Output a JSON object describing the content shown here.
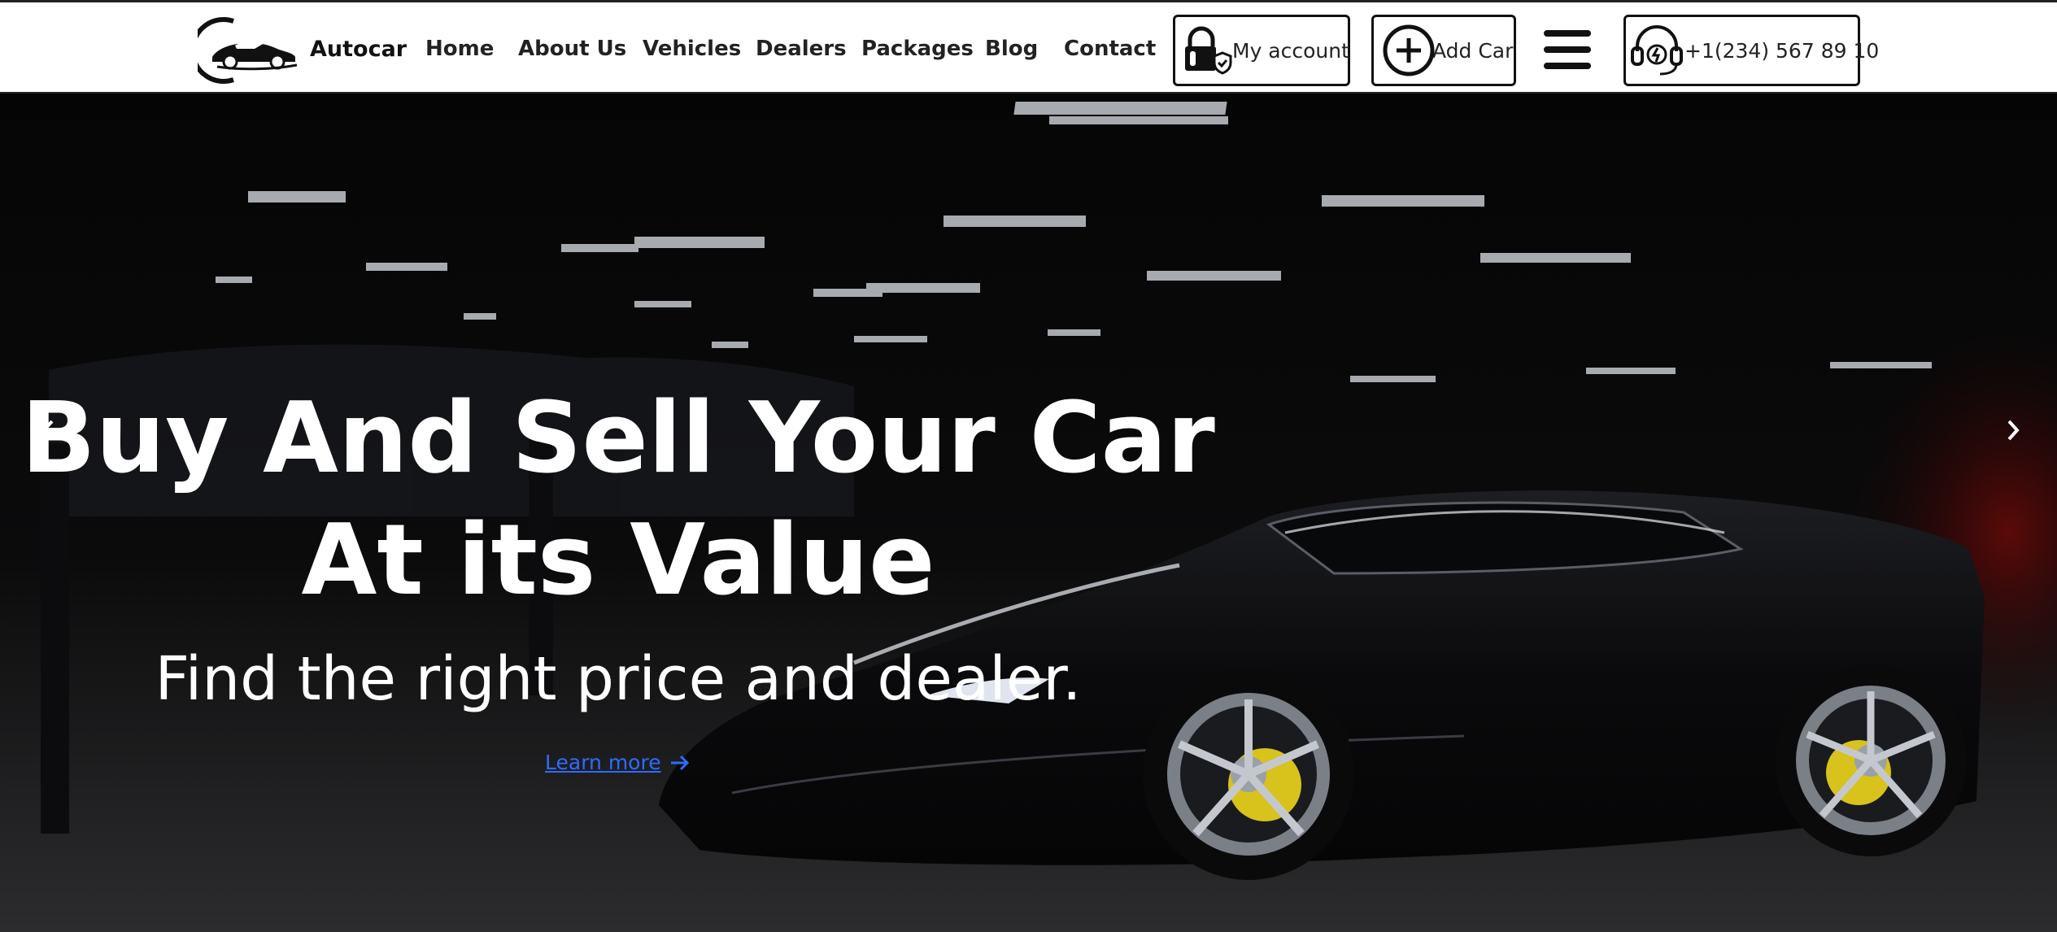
{
  "brand": {
    "name": "Autocar"
  },
  "nav": {
    "items": [
      {
        "label": "Home"
      },
      {
        "label": "About Us"
      },
      {
        "label": "Vehicles"
      },
      {
        "label": "Dealers"
      },
      {
        "label": "Packages"
      },
      {
        "label": "Blog"
      },
      {
        "label": "Contact"
      }
    ]
  },
  "header_actions": {
    "account_label": "My account",
    "add_car_label": "Add Car",
    "phone": "+1(234) 567 89 10"
  },
  "hero": {
    "title_line1": "Buy And Sell Your Car",
    "title_line2": "At its Value",
    "subtitle": "Find the right price and dealer.",
    "cta_label": "Learn more"
  },
  "icons": {
    "logo": "car-logo-icon",
    "account": "lock-shield-icon",
    "add": "plus-circle-icon",
    "menu": "hamburger-menu-icon",
    "phone": "headset-icon",
    "cta": "arrow-right-icon",
    "prev": "chevron-left-icon",
    "next": "chevron-right-icon"
  },
  "colors": {
    "header_bg": "#ffffff",
    "hero_bg": "#050505",
    "link_blue": "#2f6bff",
    "text_white": "#ffffff"
  }
}
